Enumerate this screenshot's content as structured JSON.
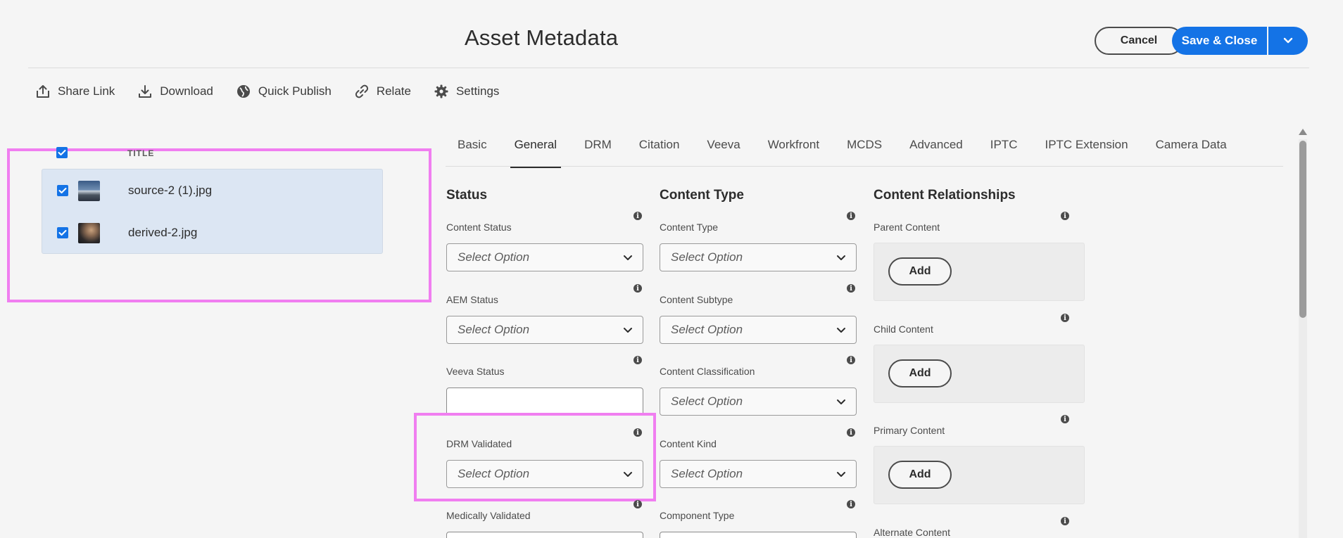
{
  "header": {
    "title": "Asset Metadata",
    "cancel_label": "Cancel",
    "save_label": "Save & Close"
  },
  "actions": [
    {
      "label": "Share Link",
      "icon": "share-icon"
    },
    {
      "label": "Download",
      "icon": "download-icon"
    },
    {
      "label": "Quick Publish",
      "icon": "globe-icon"
    },
    {
      "label": "Relate",
      "icon": "link-icon"
    },
    {
      "label": "Settings",
      "icon": "gear-icon"
    }
  ],
  "asset_list": {
    "column_header": "TITLE",
    "items": [
      {
        "name": "source-2 (1).jpg",
        "checked": true
      },
      {
        "name": "derived-2.jpg",
        "checked": true
      }
    ]
  },
  "tabs": [
    "Basic",
    "General",
    "DRM",
    "Citation",
    "Veeva",
    "Workfront",
    "MCDS",
    "Advanced",
    "IPTC",
    "IPTC Extension",
    "Camera Data"
  ],
  "active_tab": "General",
  "status_column": {
    "title": "Status",
    "fields": [
      {
        "label": "Content Status",
        "value": "Select Option"
      },
      {
        "label": "AEM Status",
        "value": "Select Option"
      },
      {
        "label": "Veeva Status",
        "value": ""
      },
      {
        "label": "DRM Validated",
        "value": "Select Option"
      },
      {
        "label": "Medically Validated",
        "value": ""
      }
    ]
  },
  "content_type_column": {
    "title": "Content Type",
    "fields": [
      {
        "label": "Content Type",
        "value": "Select Option"
      },
      {
        "label": "Content Subtype",
        "value": "Select Option"
      },
      {
        "label": "Content Classification",
        "value": "Select Option"
      },
      {
        "label": "Content Kind",
        "value": "Select Option"
      },
      {
        "label": "Component Type",
        "value": ""
      }
    ]
  },
  "relationships_column": {
    "title": "Content Relationships",
    "add_label": "Add",
    "fields": [
      {
        "label": "Parent Content"
      },
      {
        "label": "Child Content"
      },
      {
        "label": "Primary Content"
      },
      {
        "label": "Alternate Content"
      }
    ]
  },
  "colors": {
    "accent": "#1473e6",
    "highlight": "#f07ef0",
    "selection_bg": "#dce6f3"
  }
}
